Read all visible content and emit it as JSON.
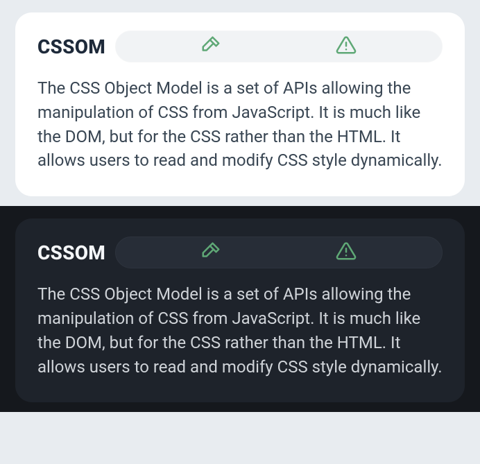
{
  "cards": [
    {
      "theme": "light",
      "title": "CSSOM",
      "body": "The CSS Object Model is a set of APIs allowing the manipulation of CSS from JavaScript. It is much like the DOM, but for the CSS rather than the HTML. It allows users to read and modify CSS style dynamically."
    },
    {
      "theme": "dark",
      "title": "CSSOM",
      "body": "The CSS Object Model is a set of APIs allowing the manipulation of CSS from JavaScript. It is much like the DOM, but for the CSS rather than the HTML. It allows users to read and modify CSS style dynamically."
    }
  ],
  "icons": {
    "hammer": "hammer-icon",
    "warning": "warning-icon"
  },
  "colors": {
    "icon_stroke": "#5fa876"
  }
}
